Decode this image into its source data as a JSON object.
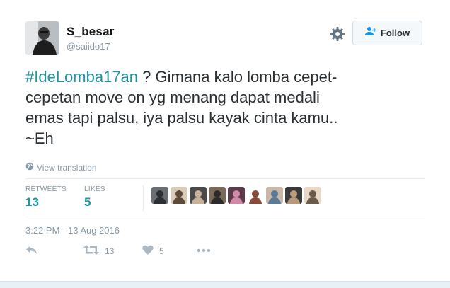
{
  "user": {
    "display_name": "S_besar",
    "handle": "@saiido17"
  },
  "header": {
    "follow_label": "Follow"
  },
  "tweet": {
    "hashtag": "#IdeLomba17an",
    "text_line1": " ? Gimana kalo lomba cepet-",
    "text_line2": "cepetan move on yg menang dapat medali",
    "text_line3": "emas tapi palsu, iya palsu kayak cinta kamu..",
    "text_line4": "~Eh"
  },
  "translate": {
    "label": "View translation"
  },
  "stats": {
    "retweets_label": "RETWEETS",
    "retweets_value": "13",
    "likes_label": "LIKES",
    "likes_value": "5"
  },
  "likers": [
    {
      "icon": "liker-avatar"
    },
    {
      "icon": "liker-avatar"
    },
    {
      "icon": "liker-avatar"
    },
    {
      "icon": "liker-avatar"
    },
    {
      "icon": "liker-avatar"
    },
    {
      "icon": "liker-avatar"
    },
    {
      "icon": "liker-avatar"
    },
    {
      "icon": "liker-avatar"
    },
    {
      "icon": "liker-avatar"
    }
  ],
  "timestamp": "3:22 PM - 13 Aug 2016",
  "actions": {
    "retweet_count": "13",
    "like_count": "5"
  },
  "colors": {
    "accent": "#1b95a0",
    "muted": "#8899a6",
    "text": "#292f33"
  }
}
